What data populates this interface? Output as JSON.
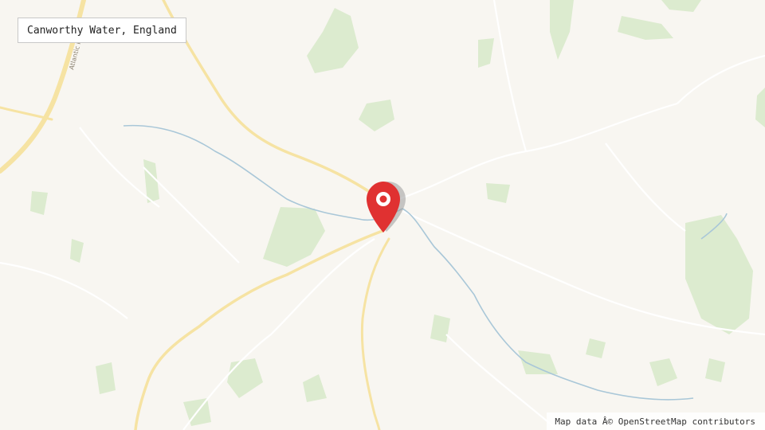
{
  "location_label": "Canworthy Water, England",
  "attribution": "Map data Â© OpenStreetMap contributors",
  "road_label": "Atlantic Highway",
  "marker_icon": "map-pin-icon",
  "colors": {
    "land": "#f8f6f1",
    "forest": "#dcebcf",
    "road_major": "#f6e3a3",
    "road_minor": "#ffffff",
    "water": "#a9c7d8",
    "marker": "#e03131"
  }
}
